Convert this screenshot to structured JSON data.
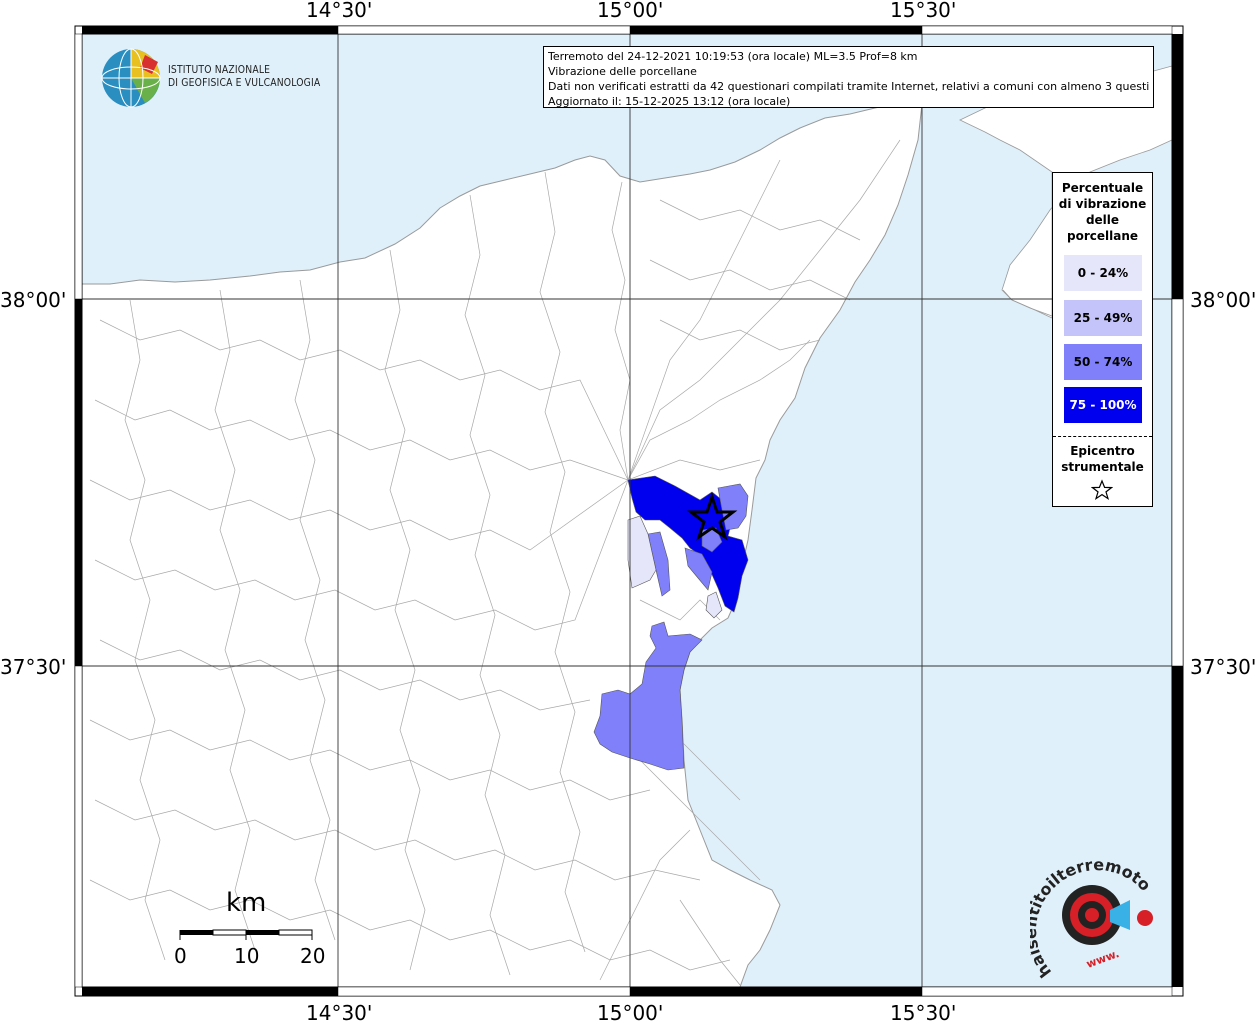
{
  "map": {
    "lon_ticks": [
      "14°30'",
      "15°00'",
      "15°30'"
    ],
    "lat_ticks": [
      "38°00'",
      "37°30'"
    ],
    "colors": {
      "sea": "#dff0fb",
      "land": "#ffffff",
      "borders": "#9a9a9a",
      "class_0_24": "#e6e6fb",
      "class_25_49": "#c4c4fa",
      "class_50_74": "#8080fa",
      "class_75_100": "#0000ee"
    }
  },
  "info": {
    "line1": "Terremoto del 24-12-2021 10:19:53 (ora locale) ML=3.5 Prof=8 km",
    "line2": "Vibrazione delle porcellane",
    "line3": "Dati non verificati estratti da 42 questionari compilati tramite Internet, relativi a comuni con almeno 3 questionari.",
    "line4": "Aggiornato il: 15-12-2025 13:12 (ora locale)"
  },
  "logo": {
    "line1": "ISTITUTO NAZIONALE",
    "line2": "DI GEOFISICA E VULCANOLOGIA"
  },
  "legend": {
    "title_lines": [
      "Percentuale",
      "di vibrazione",
      "delle",
      "porcellane"
    ],
    "items": [
      {
        "label": "0 - 24%",
        "color": "#e6e6fb"
      },
      {
        "label": "25 - 49%",
        "color": "#c4c4fa"
      },
      {
        "label": "50 - 74%",
        "color": "#8080fa"
      },
      {
        "label": "75 - 100%",
        "color": "#0000ee",
        "text_color": "#ffffff"
      }
    ],
    "epicenter_lines": [
      "Epicentro",
      "strumentale"
    ],
    "epicenter_icon": "star-outline-icon"
  },
  "scale": {
    "unit": "km",
    "labels": [
      "0",
      "10",
      "20"
    ]
  },
  "branding": {
    "hs_text": "haisentitoilterremoto.it",
    "hs_url": "www."
  }
}
